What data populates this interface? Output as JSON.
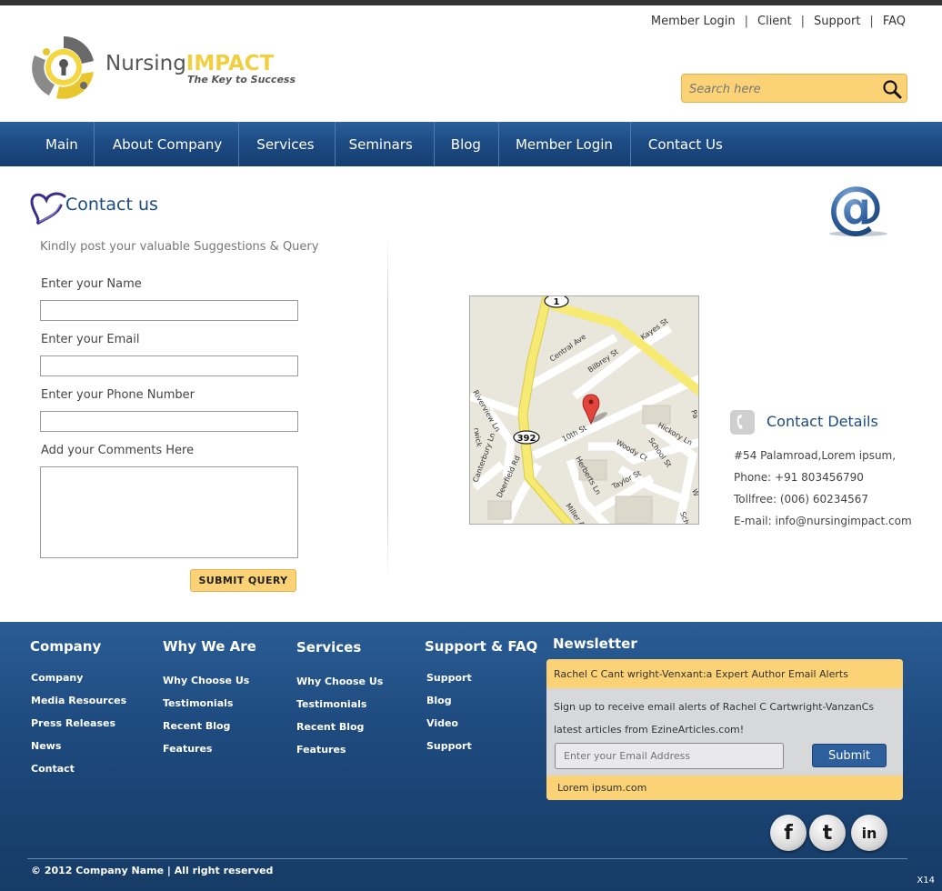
{
  "brand": {
    "name_part1": "Nursing",
    "name_part2": "IMPACT",
    "tagline": "The Key to Success"
  },
  "top_links": [
    "Member Login",
    "Client",
    "Support",
    "FAQ"
  ],
  "search": {
    "placeholder": "Search here"
  },
  "nav": [
    "Main",
    "About Company",
    "Services",
    "Seminars",
    "Blog",
    "Member Login",
    "Contact Us"
  ],
  "contact": {
    "title": "Contact us",
    "intro": "Kindly post your valuable Suggestions &  Query",
    "labels": {
      "name": "Enter your Name",
      "email": "Enter your Email",
      "phone": "Enter your Phone Number",
      "comments": "Add your Comments Here"
    },
    "values": {
      "name": "",
      "email": "",
      "phone": "",
      "comments": ""
    },
    "submit": "SUBMIT QUERY"
  },
  "map_labels": {
    "route_1": "1",
    "route_392": "392",
    "streets": [
      "Central Ave",
      "Bilbrey St",
      "Kayes St",
      "10th St",
      "Hickory Ln",
      "Woody Ct",
      "School St",
      "Herberts Ln",
      "Taylor St",
      "Deerfield Rd",
      "Canterbury Ln",
      "Riverview Ln",
      "Miller A",
      "Pa",
      "W",
      "Sch",
      "rwick"
    ]
  },
  "contact_details": {
    "title": "Contact Details",
    "address": "#54 Palamroad,Lorem ipsum,",
    "phone": "Phone: +91 803456790",
    "tollfree": "Tollfree: (006) 60234567",
    "email": "E-mail: info@nursingimpact.com"
  },
  "footer": {
    "columns": [
      {
        "title": "Company",
        "links": [
          "Company",
          "Media Resources",
          "Press Releases",
          "News",
          "Contact"
        ]
      },
      {
        "title": "Why We Are",
        "links": [
          "Why Choose Us",
          "Testimonials",
          "Recent Blog",
          "Features"
        ]
      },
      {
        "title": "Services",
        "links": [
          "Why Choose Us",
          "Testimonials",
          "Recent Blog",
          "Features"
        ]
      },
      {
        "title": "Support & FAQ",
        "links": [
          "Support",
          "Blog",
          "Video",
          "Support"
        ]
      }
    ],
    "newsletter": {
      "title": "Newsletter",
      "header": "Rachel C Cant wright-Venxant:a Expert Author Email Alerts",
      "description": "Sign up to receive email alerts of Rachel C Cartwright-VanzanCs latest articles from EzineArticles.com!",
      "email_placeholder": "Enter your Email Address",
      "submit": "Submit",
      "footer_text": "Lorem ipsum.com"
    },
    "social": [
      "f",
      "t",
      "in"
    ],
    "copyright": "© 2012 Company Name  |  All right reserved",
    "version": "X14"
  },
  "colors": {
    "nav_blue": "#1c4a82",
    "accent_yellow": "#fbd275",
    "footer_blue": "#1e4a7e"
  },
  "icons": [
    "search-icon",
    "heart-icon",
    "at-icon",
    "phone-icon",
    "facebook-icon",
    "twitter-icon",
    "linkedin-icon",
    "map-pin-icon"
  ]
}
